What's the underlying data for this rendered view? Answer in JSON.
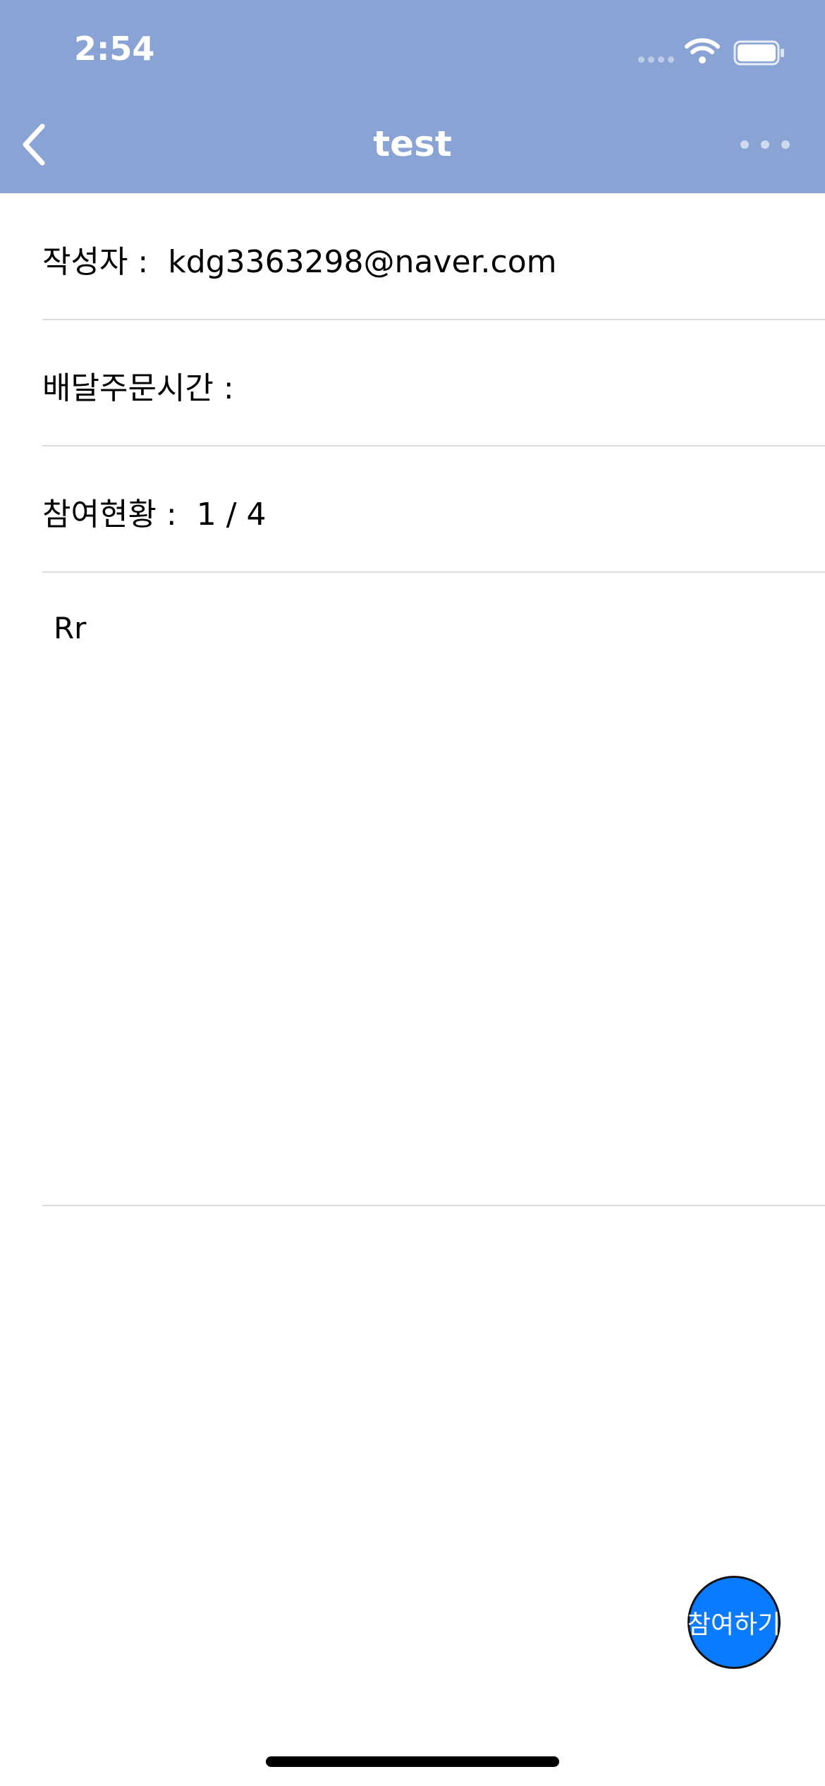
{
  "colors": {
    "header": "#8aa3d5",
    "accent": "#0a7bff"
  },
  "status_bar": {
    "time": "2:54",
    "icons": [
      "cellular-signal-icon",
      "wifi-icon",
      "battery-icon"
    ]
  },
  "nav": {
    "title": "test",
    "back_icon": "chevron-left-icon",
    "more_icon": "ellipsis-icon"
  },
  "details": {
    "writer_label": "작성자 :",
    "writer_value": "kdg3363298@naver.com",
    "delivery_label": "배달주문시간 :",
    "delivery_value": "",
    "participants_label": "참여현황 :",
    "participants_value": "1 / 4"
  },
  "content": {
    "body": "Rr"
  },
  "join_button": {
    "label": "참여하기"
  }
}
